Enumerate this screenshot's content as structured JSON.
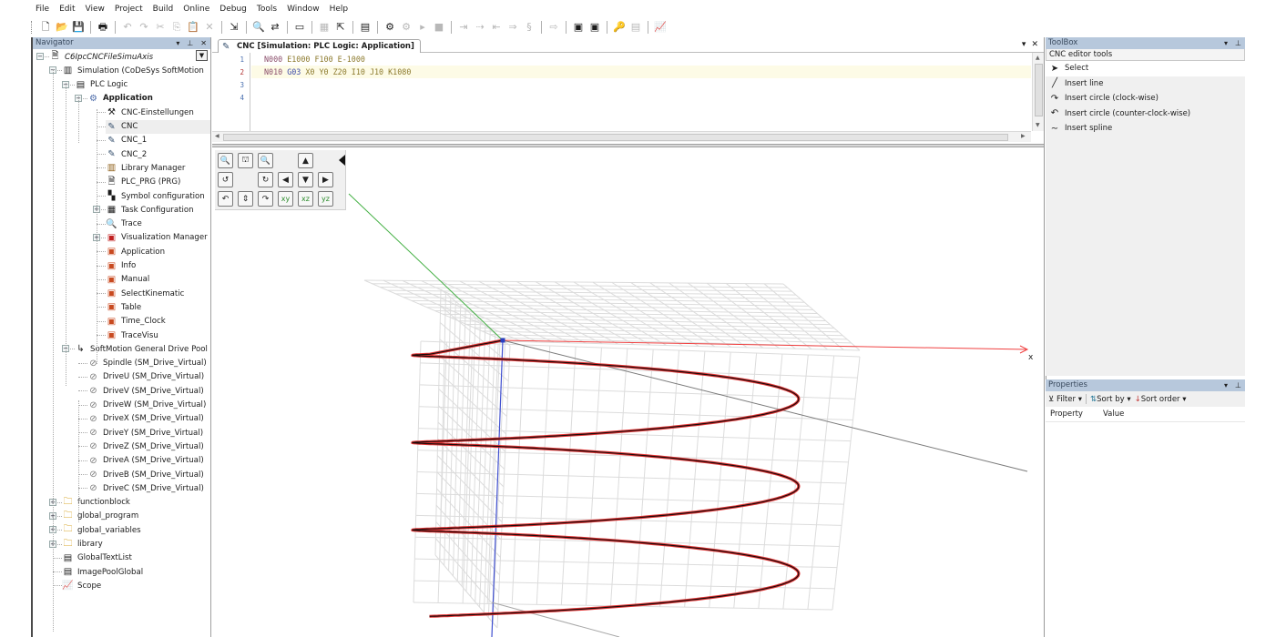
{
  "menubar": {
    "items": [
      {
        "label": "File",
        "u": "F"
      },
      {
        "label": "Edit",
        "u": "E"
      },
      {
        "label": "View",
        "u": "V"
      },
      {
        "label": "Project",
        "u": "P"
      },
      {
        "label": "Build",
        "u": "B"
      },
      {
        "label": "Online",
        "u": "O"
      },
      {
        "label": "Debug",
        "u": "D"
      },
      {
        "label": "Tools",
        "u": "T"
      },
      {
        "label": "Window",
        "u": "W"
      },
      {
        "label": "Help",
        "u": "H"
      }
    ]
  },
  "toolbar": {
    "buttons": [
      {
        "name": "new-project",
        "glyph": "🗋",
        "enabled": true
      },
      {
        "name": "open-project",
        "glyph": "📂",
        "enabled": true
      },
      {
        "name": "save-project",
        "glyph": "💾",
        "enabled": true
      },
      {
        "sep": true
      },
      {
        "name": "print",
        "glyph": "🖶",
        "enabled": true
      },
      {
        "sep": true
      },
      {
        "name": "undo",
        "glyph": "↶",
        "enabled": false
      },
      {
        "name": "redo",
        "glyph": "↷",
        "enabled": false
      },
      {
        "name": "cut",
        "glyph": "✂",
        "enabled": false
      },
      {
        "name": "copy",
        "glyph": "⎘",
        "enabled": false
      },
      {
        "name": "paste",
        "glyph": "📋",
        "enabled": false
      },
      {
        "name": "delete",
        "glyph": "✕",
        "enabled": false
      },
      {
        "sep": true
      },
      {
        "name": "import",
        "glyph": "⇲",
        "enabled": true
      },
      {
        "sep": true
      },
      {
        "name": "find",
        "glyph": "🔍",
        "enabled": true
      },
      {
        "name": "replace",
        "glyph": "⇄",
        "enabled": true
      },
      {
        "sep": true
      },
      {
        "name": "windows",
        "glyph": "▭",
        "enabled": true
      },
      {
        "sep": true
      },
      {
        "name": "insert-object",
        "glyph": "▦",
        "enabled": false
      },
      {
        "name": "properties",
        "glyph": "⇱",
        "enabled": true
      },
      {
        "sep": true
      },
      {
        "name": "simulation",
        "glyph": "▤",
        "enabled": true
      },
      {
        "sep": true
      },
      {
        "name": "login",
        "glyph": "⚙",
        "enabled": true
      },
      {
        "name": "logout",
        "glyph": "⚙",
        "enabled": false
      },
      {
        "name": "start",
        "glyph": "▸",
        "enabled": false
      },
      {
        "name": "stop",
        "glyph": "■",
        "enabled": false
      },
      {
        "sep": true
      },
      {
        "name": "step-into",
        "glyph": "⇥",
        "enabled": false
      },
      {
        "name": "step-over",
        "glyph": "⇢",
        "enabled": false
      },
      {
        "name": "step-out",
        "glyph": "⇤",
        "enabled": false
      },
      {
        "name": "run-to-cursor",
        "glyph": "⇒",
        "enabled": false
      },
      {
        "name": "breakpoints",
        "glyph": "§",
        "enabled": false
      },
      {
        "sep": true
      },
      {
        "name": "show-next",
        "glyph": "⇨",
        "enabled": false
      },
      {
        "sep": true
      },
      {
        "name": "device-scan",
        "glyph": "▣",
        "enabled": true
      },
      {
        "name": "device-search",
        "glyph": "▣",
        "enabled": true
      },
      {
        "sep": true
      },
      {
        "name": "force-values",
        "glyph": "🔑",
        "enabled": false
      },
      {
        "name": "write-values",
        "glyph": "▤",
        "enabled": false
      },
      {
        "sep": true
      },
      {
        "name": "scope",
        "glyph": "📈",
        "enabled": true
      }
    ]
  },
  "navigator": {
    "title": "Navigator",
    "tree": [
      {
        "label": "C6IpcCNCFileSimuAxis",
        "level": 0,
        "icon": "project-icon",
        "glyph": "🗎",
        "style": "italic",
        "expander": "-"
      },
      {
        "label": "Simulation (CoDeSys SoftMotion",
        "level": 1,
        "icon": "device-icon",
        "glyph": "▥",
        "expander": "-"
      },
      {
        "label": "PLC Logic",
        "level": 2,
        "icon": "plc-logic-icon",
        "glyph": "▤",
        "expander": "-"
      },
      {
        "label": "Application",
        "level": 3,
        "icon": "application-icon",
        "glyph": "⚙",
        "style": "bold",
        "expander": "-"
      },
      {
        "label": "CNC-Einstellungen",
        "level": 4,
        "icon": "cnc-settings-icon",
        "glyph": "⚒"
      },
      {
        "label": "CNC",
        "level": 4,
        "icon": "cnc-icon",
        "glyph": "✎",
        "selected": true
      },
      {
        "label": "CNC_1",
        "level": 4,
        "icon": "cnc-icon",
        "glyph": "✎"
      },
      {
        "label": "CNC_2",
        "level": 4,
        "icon": "cnc-icon",
        "glyph": "✎"
      },
      {
        "label": "Library Manager",
        "level": 4,
        "icon": "library-manager-icon",
        "glyph": "▥"
      },
      {
        "label": "PLC_PRG (PRG)",
        "level": 4,
        "icon": "program-icon",
        "glyph": "🗎"
      },
      {
        "label": "Symbol configuration",
        "level": 4,
        "icon": "symbol-config-icon",
        "glyph": "▚"
      },
      {
        "label": "Task Configuration",
        "level": 4,
        "icon": "task-config-icon",
        "glyph": "▦",
        "expander": "+"
      },
      {
        "label": "Trace",
        "level": 4,
        "icon": "trace-icon",
        "glyph": "🔍"
      },
      {
        "label": "Visualization Manager",
        "level": 4,
        "icon": "visu-manager-icon",
        "glyph": "▣",
        "expander": "+"
      },
      {
        "label": "Application",
        "level": 4,
        "icon": "visualization-icon",
        "glyph": "▣"
      },
      {
        "label": "Info",
        "level": 4,
        "icon": "visualization-icon",
        "glyph": "▣"
      },
      {
        "label": "Manual",
        "level": 4,
        "icon": "visualization-icon",
        "glyph": "▣"
      },
      {
        "label": "SelectKinematic",
        "level": 4,
        "icon": "visualization-icon",
        "glyph": "▣"
      },
      {
        "label": "Table",
        "level": 4,
        "icon": "visualization-icon",
        "glyph": "▣"
      },
      {
        "label": "Time_Clock",
        "level": 4,
        "icon": "visualization-icon",
        "glyph": "▣"
      },
      {
        "label": "TraceVisu",
        "level": 4,
        "icon": "visualization-icon",
        "glyph": "▣"
      },
      {
        "label": "SoftMotion General Drive Pool",
        "level": 2,
        "icon": "drive-pool-icon",
        "glyph": "↳",
        "expander": "-"
      },
      {
        "label": "Spindle (SM_Drive_Virtual)",
        "level": 3,
        "icon": "drive-icon",
        "glyph": "⊘"
      },
      {
        "label": "DriveU (SM_Drive_Virtual)",
        "level": 3,
        "icon": "drive-icon",
        "glyph": "⊘"
      },
      {
        "label": "DriveV (SM_Drive_Virtual)",
        "level": 3,
        "icon": "drive-icon",
        "glyph": "⊘"
      },
      {
        "label": "DriveW (SM_Drive_Virtual)",
        "level": 3,
        "icon": "drive-icon",
        "glyph": "⊘"
      },
      {
        "label": "DriveX (SM_Drive_Virtual)",
        "level": 3,
        "icon": "drive-icon",
        "glyph": "⊘"
      },
      {
        "label": "DriveY (SM_Drive_Virtual)",
        "level": 3,
        "icon": "drive-icon",
        "glyph": "⊘"
      },
      {
        "label": "DriveZ (SM_Drive_Virtual)",
        "level": 3,
        "icon": "drive-icon",
        "glyph": "⊘"
      },
      {
        "label": "DriveA (SM_Drive_Virtual)",
        "level": 3,
        "icon": "drive-icon",
        "glyph": "⊘"
      },
      {
        "label": "DriveB (SM_Drive_Virtual)",
        "level": 3,
        "icon": "drive-icon",
        "glyph": "⊘"
      },
      {
        "label": "DriveC (SM_Drive_Virtual)",
        "level": 3,
        "icon": "drive-icon",
        "glyph": "⊘"
      },
      {
        "label": "functionblock",
        "level": 1,
        "icon": "folder-icon",
        "glyph": "🗀",
        "expander": "+"
      },
      {
        "label": "global_program",
        "level": 1,
        "icon": "folder-icon",
        "glyph": "🗀",
        "expander": "+"
      },
      {
        "label": "global_variables",
        "level": 1,
        "icon": "folder-icon",
        "glyph": "🗀",
        "expander": "+"
      },
      {
        "label": "library",
        "level": 1,
        "icon": "folder-icon",
        "glyph": "🗀",
        "expander": "+"
      },
      {
        "label": "GlobalTextList",
        "level": 1,
        "icon": "text-list-icon",
        "glyph": "▤"
      },
      {
        "label": "ImagePoolGlobal",
        "level": 1,
        "icon": "image-pool-icon",
        "glyph": "▤"
      },
      {
        "label": "Scope",
        "level": 1,
        "icon": "scope-icon",
        "glyph": "📈"
      }
    ]
  },
  "editor": {
    "tab_label": "CNC [Simulation: PLC Logic: Application]",
    "lines": [
      {
        "num": "1",
        "tokens": [
          [
            "n",
            "N000"
          ],
          [
            "x",
            " E1000 F100 E-1000"
          ]
        ]
      },
      {
        "num": "2",
        "tokens": [
          [
            "n",
            "N010"
          ],
          [
            "g",
            " G03"
          ],
          [
            "x",
            " X0 Y0 Z20 I10 J10 K1080"
          ]
        ],
        "current": true
      },
      {
        "num": "3",
        "tokens": []
      },
      {
        "num": "4",
        "tokens": []
      }
    ],
    "axis_label_x": "x"
  },
  "view_toolbar": {
    "buttons": [
      {
        "name": "zoom-out",
        "glyph": "🔍",
        "row": 0,
        "col": 0
      },
      {
        "name": "zoom-fit",
        "glyph": "⛫",
        "row": 0,
        "col": 1
      },
      {
        "name": "zoom-in",
        "glyph": "🔍",
        "row": 0,
        "col": 2
      },
      {
        "name": "move-up",
        "glyph": "▲",
        "row": 0,
        "col": 4
      },
      {
        "name": "rotate-left",
        "glyph": "↺",
        "row": 1,
        "col": 0
      },
      {
        "name": "rotate-right",
        "glyph": "↻",
        "row": 1,
        "col": 2
      },
      {
        "name": "move-left",
        "glyph": "◀",
        "row": 1,
        "col": 3
      },
      {
        "name": "move-down",
        "glyph": "▼",
        "row": 1,
        "col": 4
      },
      {
        "name": "move-right",
        "glyph": "▶",
        "row": 1,
        "col": 5
      },
      {
        "name": "tilt-back",
        "glyph": "↶",
        "row": 2,
        "col": 0
      },
      {
        "name": "tilt-center",
        "glyph": "⇕",
        "row": 2,
        "col": 1
      },
      {
        "name": "tilt-forward",
        "glyph": "↷",
        "row": 2,
        "col": 2
      },
      {
        "name": "view-xy",
        "glyph": "xy",
        "row": 2,
        "col": 3,
        "axes": true
      },
      {
        "name": "view-xz",
        "glyph": "xz",
        "row": 2,
        "col": 4,
        "axes": true
      },
      {
        "name": "view-yz",
        "glyph": "yz",
        "row": 2,
        "col": 5,
        "axes": true
      }
    ]
  },
  "toolbox": {
    "title": "ToolBox",
    "group": "CNC editor tools",
    "items": [
      {
        "label": "Select",
        "icon": "cursor-icon",
        "glyph": "➤",
        "selected": true
      },
      {
        "label": "Insert line",
        "icon": "line-icon",
        "glyph": "╱"
      },
      {
        "label": "Insert circle (clock-wise)",
        "icon": "circle-cw-icon",
        "glyph": "↷"
      },
      {
        "label": "Insert circle (counter-clock-wise)",
        "icon": "circle-ccw-icon",
        "glyph": "↶"
      },
      {
        "label": "Insert spline",
        "icon": "spline-icon",
        "glyph": "∼"
      }
    ]
  },
  "properties": {
    "title": "Properties",
    "filter_label": "Filter",
    "sort_by_label": "Sort by",
    "sort_order_label": "Sort order",
    "col_property": "Property",
    "col_value": "Value"
  },
  "colors": {
    "panel_title_bg": "#b7c8dc",
    "path_red": "#e02020",
    "axis_x": "#f04040",
    "axis_y": "#44b044",
    "axis_z": "#4050d0"
  }
}
